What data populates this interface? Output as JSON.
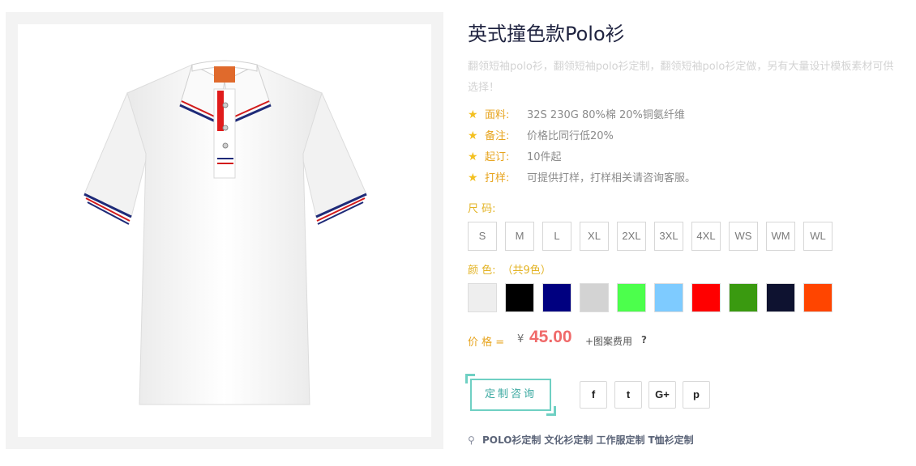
{
  "product": {
    "title": "英式撞色款Polo衫",
    "description": "翻领短袖polo衫，翻领短袖polo衫定制，翻领短袖polo衫定做，另有大量设计模板素材可供选择！",
    "specs": [
      {
        "label": "面料:",
        "value": "32S 230G 80%棉 20%铜氨纤维"
      },
      {
        "label": "备注:",
        "value": "价格比同行低20%"
      },
      {
        "label": "起订:",
        "value": "10件起"
      },
      {
        "label": "打样:",
        "value": "可提供打样，打样相关请咨询客服。"
      }
    ],
    "size_label": "尺 码:",
    "sizes": [
      "S",
      "M",
      "L",
      "XL",
      "2XL",
      "3XL",
      "4XL",
      "WS",
      "WM",
      "WL"
    ],
    "color_label": "颜 色:",
    "color_count": "（共9色）",
    "colors": [
      "#eeeeee",
      "#000000",
      "#000080",
      "#d3d3d3",
      "#4cff4c",
      "#7ecbff",
      "#ff0000",
      "#3a9a10",
      "#0e1230",
      "#ff4500"
    ],
    "price_label": "价 格 =",
    "currency": "¥",
    "price": "45.00",
    "price_extra": "+图案费用",
    "price_help": "?",
    "consult_button": "定制咨询",
    "share": {
      "facebook": "f",
      "twitter": "t",
      "googleplus": "G+",
      "pinterest": "p"
    },
    "tags": [
      "POLO衫定制",
      "文化衫定制",
      "工作服定制",
      "T恤衫定制"
    ]
  },
  "icons": {
    "star": "star-icon",
    "tag": "key-icon"
  },
  "theme": {
    "accent": "#e7a41e",
    "price": "#f06a6a",
    "button": "#6fd0c3"
  }
}
